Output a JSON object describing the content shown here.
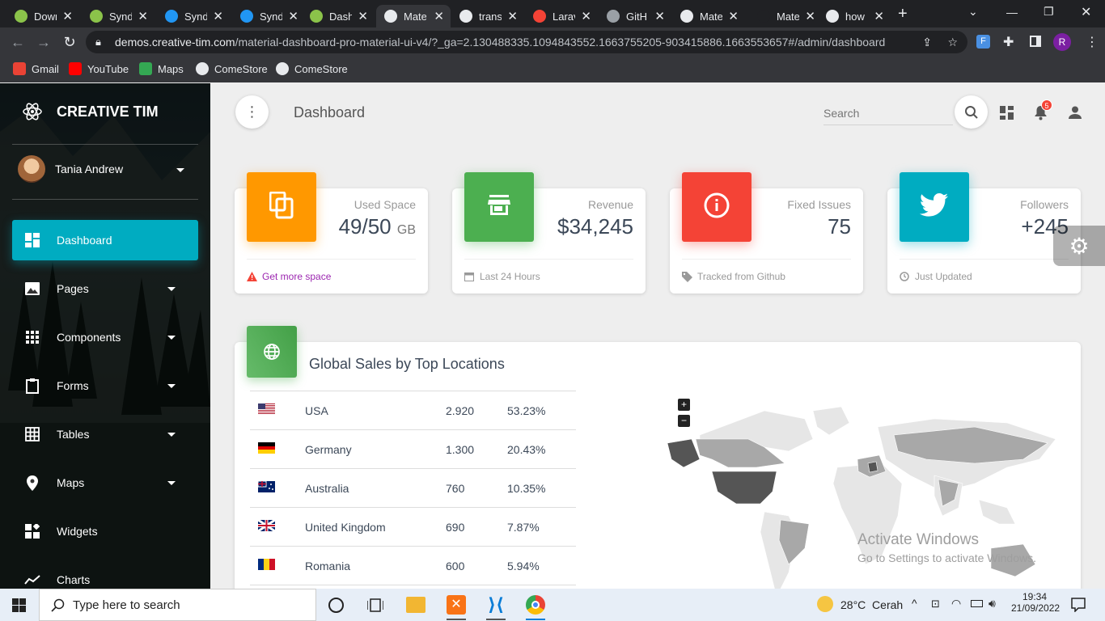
{
  "browser": {
    "tabs": [
      {
        "label": "Down",
        "color": "#8bc34a"
      },
      {
        "label": "Synd",
        "color": "#8bc34a"
      },
      {
        "label": "Synd",
        "color": "#2196f3"
      },
      {
        "label": "Synd",
        "color": "#2196f3"
      },
      {
        "label": "Dash",
        "color": "#8bc34a"
      },
      {
        "label": "Mate",
        "color": "#e8eaed"
      },
      {
        "label": "trans",
        "color": "#e8eaed"
      },
      {
        "label": "Larav",
        "color": "#f44336"
      },
      {
        "label": "GitH",
        "color": "#9aa0a6"
      },
      {
        "label": "Mate",
        "color": "#e8eaed"
      },
      {
        "label": "Mate",
        "color": "#202124"
      },
      {
        "label": "how",
        "color": "#e8eaed"
      }
    ],
    "url_host": "demos.creative-tim.com",
    "url_path": "/material-dashboard-pro-material-ui-v4/?_ga=2.130488335.1094843552.1663755205-903415886.1663553657#/admin/dashboard",
    "profile_initial": "R",
    "bookmarks": [
      {
        "label": "Gmail",
        "color": "#ea4335"
      },
      {
        "label": "YouTube",
        "color": "#ff0000"
      },
      {
        "label": "Maps",
        "color": "#34a853"
      },
      {
        "label": "ComeStore",
        "color": "#e8eaed"
      },
      {
        "label": "ComeStore",
        "color": "#e8eaed"
      }
    ]
  },
  "sidebar": {
    "brand": "CREATIVE TIM",
    "user": "Tania Andrew",
    "items": [
      {
        "label": "Dashboard",
        "icon": "dashboard-icon",
        "active": true
      },
      {
        "label": "Pages",
        "icon": "image-icon"
      },
      {
        "label": "Components",
        "icon": "apps-icon"
      },
      {
        "label": "Forms",
        "icon": "clipboard-icon"
      },
      {
        "label": "Tables",
        "icon": "grid-icon"
      },
      {
        "label": "Maps",
        "icon": "place-icon"
      },
      {
        "label": "Widgets",
        "icon": "widgets-icon"
      },
      {
        "label": "Charts",
        "icon": "timeline-icon"
      }
    ]
  },
  "header": {
    "title": "Dashboard",
    "search_placeholder": "Search",
    "notification_count": "5"
  },
  "stats": [
    {
      "category": "Used Space",
      "value": "49/50",
      "unit": "GB",
      "footer": "Get more space",
      "color": "#ff9800",
      "footer_color": "#9c27b0"
    },
    {
      "category": "Revenue",
      "value": "$34,245",
      "unit": "",
      "footer": "Last 24 Hours",
      "color": "#4caf50",
      "footer_color": "#999999"
    },
    {
      "category": "Fixed Issues",
      "value": "75",
      "unit": "",
      "footer": "Tracked from Github",
      "color": "#f44336",
      "footer_color": "#999999"
    },
    {
      "category": "Followers",
      "value": "+245",
      "unit": "",
      "footer": "Just Updated",
      "color": "#00acc1",
      "footer_color": "#999999"
    }
  ],
  "sales": {
    "title": "Global Sales by Top Locations",
    "rows": [
      {
        "country": "USA",
        "sales": "2.920",
        "percent": "53.23%"
      },
      {
        "country": "Germany",
        "sales": "1.300",
        "percent": "20.43%"
      },
      {
        "country": "Australia",
        "sales": "760",
        "percent": "10.35%"
      },
      {
        "country": "United Kingdom",
        "sales": "690",
        "percent": "7.87%"
      },
      {
        "country": "Romania",
        "sales": "600",
        "percent": "5.94%"
      }
    ],
    "zoom_in": "+",
    "zoom_out": "−"
  },
  "watermark": {
    "line1": "Activate Windows",
    "line2": "Go to Settings to activate Windows."
  },
  "taskbar": {
    "search_placeholder": "Type here to search",
    "weather": "28°C  Cerah",
    "time": "19:34",
    "date": "21/09/2022"
  }
}
